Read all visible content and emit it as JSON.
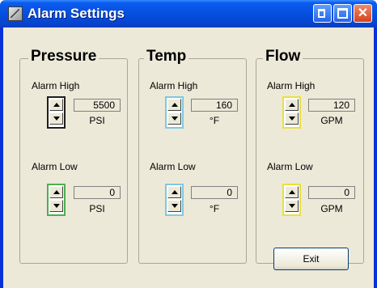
{
  "window": {
    "title": "Alarm Settings",
    "icons": {
      "app": "alarm-app-icon",
      "minimize": "minimize-icon",
      "maximize": "maximize-icon",
      "close": "close-icon"
    },
    "close_glyph": "✕"
  },
  "groups": [
    {
      "label": "Pressure",
      "accent": "#4caf50",
      "high": {
        "label": "Alarm High",
        "value": "5500",
        "unit": "PSI"
      },
      "low": {
        "label": "Alarm Low",
        "value": "0",
        "unit": "PSI"
      }
    },
    {
      "label": "Temp",
      "accent": "#7ec8e3",
      "high": {
        "label": "Alarm High",
        "value": "160",
        "unit": "°F"
      },
      "low": {
        "label": "Alarm Low",
        "value": "0",
        "unit": "°F"
      }
    },
    {
      "label": "Flow",
      "accent": "#e8e040",
      "high": {
        "label": "Alarm High",
        "value": "120",
        "unit": "GPM"
      },
      "low": {
        "label": "Alarm Low",
        "value": "0",
        "unit": "GPM"
      }
    }
  ],
  "footer": {
    "exit_label": "Exit"
  }
}
